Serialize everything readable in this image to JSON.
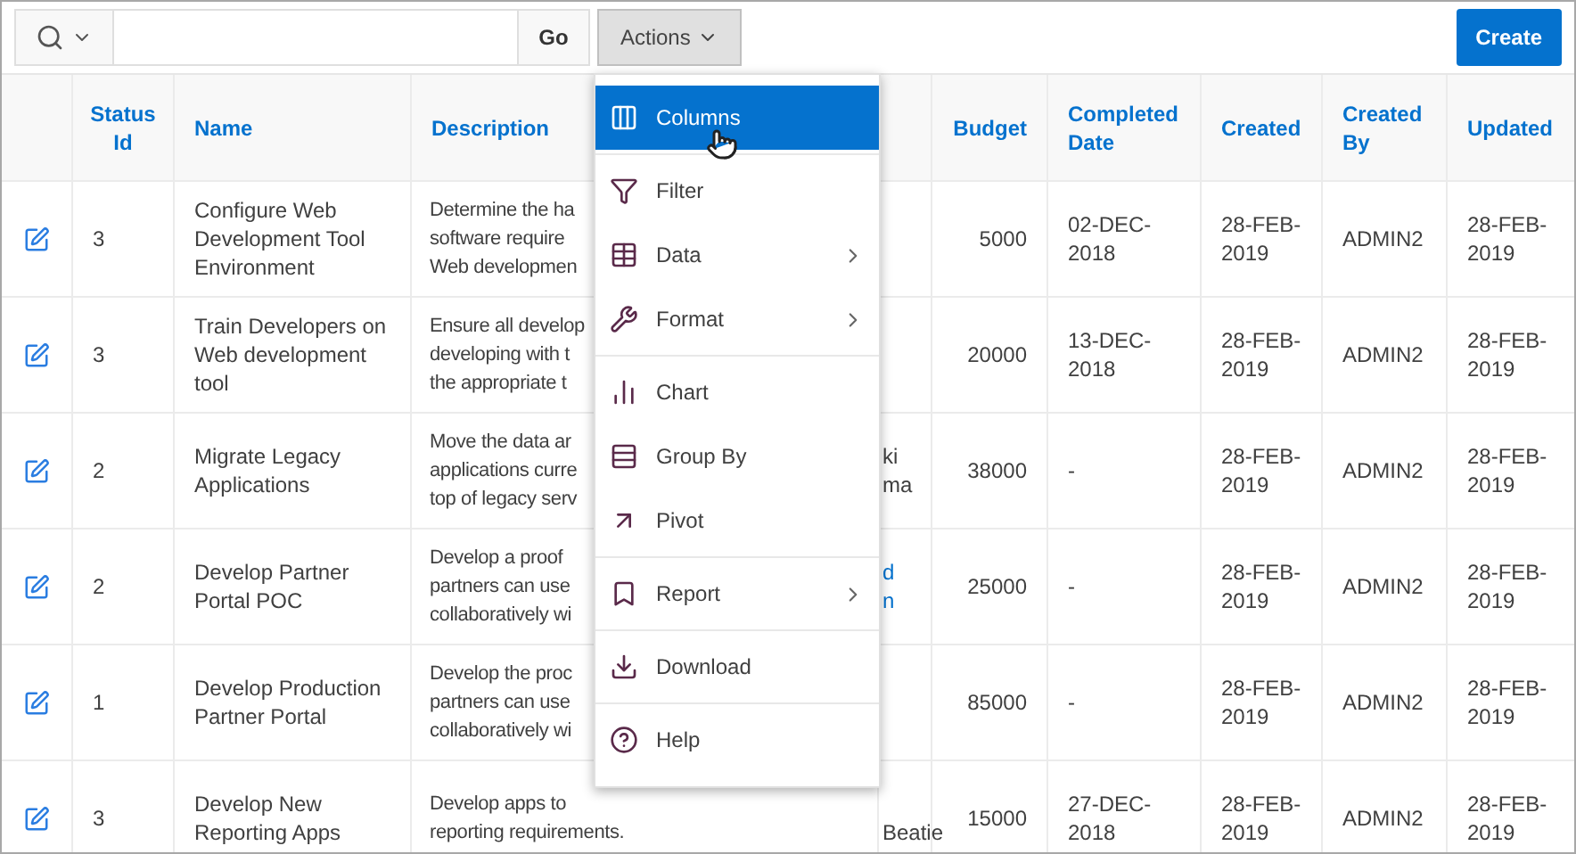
{
  "toolbar": {
    "go_label": "Go",
    "actions_label": "Actions",
    "actions_expanded": true,
    "create_label": "Create"
  },
  "table": {
    "columns": [
      "",
      "Status Id",
      "Name",
      "Description",
      "",
      "Budget",
      "Completed Date",
      "Created",
      "Created By",
      "Updated"
    ],
    "rows": [
      {
        "status_id": "3",
        "name": "Configure Web Development Tool Environment",
        "description": [
          "Determine the ha",
          "software require",
          "Web developmen"
        ],
        "budget": "5000",
        "completed_date": "02-DEC-2018",
        "created": "28-FEB-2019",
        "created_by": "ADMIN2",
        "updated": "28-FEB-2019"
      },
      {
        "status_id": "3",
        "name": "Train Developers on Web development tool",
        "description": [
          "Ensure all develop",
          "developing with t",
          "the appropriate t"
        ],
        "budget": "20000",
        "completed_date": "13-DEC-2018",
        "created": "28-FEB-2019",
        "created_by": "ADMIN2",
        "updated": "28-FEB-2019"
      },
      {
        "status_id": "2",
        "name": "Migrate Legacy Applications",
        "description": [
          "Move the data ar",
          "applications curre",
          "top of legacy serv"
        ],
        "column_5": {
          "lines": [
            "ki",
            "ma"
          ],
          "link": false
        },
        "budget": "38000",
        "completed_date": "-",
        "created": "28-FEB-2019",
        "created_by": "ADMIN2",
        "updated": "28-FEB-2019"
      },
      {
        "status_id": "2",
        "name": "Develop Partner Portal POC",
        "description": [
          "Develop a proof",
          "partners can use",
          "collaboratively wi"
        ],
        "column_5": {
          "lines": [
            "d",
            "n"
          ],
          "link": true
        },
        "budget": "25000",
        "completed_date": "-",
        "created": "28-FEB-2019",
        "created_by": "ADMIN2",
        "updated": "28-FEB-2019"
      },
      {
        "status_id": "1",
        "name": "Develop Production Partner Portal",
        "description": [
          "Develop the proc",
          "partners can use",
          "collaboratively wi"
        ],
        "budget": "85000",
        "completed_date": "-",
        "created": "28-FEB-2019",
        "created_by": "ADMIN2",
        "updated": "28-FEB-2019"
      },
      {
        "status_id": "3",
        "name": "Develop New Reporting Apps",
        "description": [
          "Develop apps to",
          "reporting requirements."
        ],
        "column_5": {
          "lines": [
            "Beatie"
          ],
          "link": false
        },
        "budget": "15000",
        "completed_date": "27-DEC-2018",
        "created": "28-FEB-2019",
        "created_by": "ADMIN2",
        "updated": "28-FEB-2019"
      }
    ]
  },
  "actions_menu": {
    "groups": [
      [
        {
          "label": "Columns",
          "selected": true,
          "has_submenu": false
        }
      ],
      [
        {
          "label": "Filter",
          "selected": false,
          "has_submenu": false
        },
        {
          "label": "Data",
          "selected": false,
          "has_submenu": true
        },
        {
          "label": "Format",
          "selected": false,
          "has_submenu": true
        }
      ],
      [
        {
          "label": "Chart",
          "selected": false,
          "has_submenu": false
        },
        {
          "label": "Group By",
          "selected": false,
          "has_submenu": false
        },
        {
          "label": "Pivot",
          "selected": false,
          "has_submenu": false
        }
      ],
      [
        {
          "label": "Report",
          "selected": false,
          "has_submenu": true
        }
      ],
      [
        {
          "label": "Download",
          "selected": false,
          "has_submenu": false
        }
      ],
      [
        {
          "label": "Help",
          "selected": false,
          "has_submenu": false
        }
      ]
    ]
  }
}
